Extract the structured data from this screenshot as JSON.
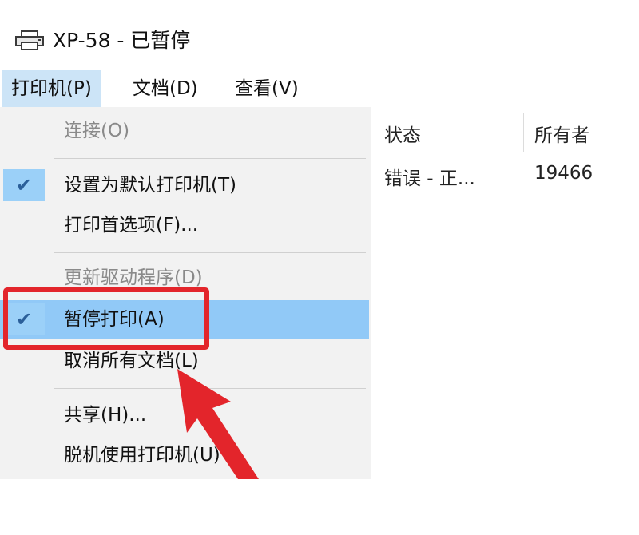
{
  "window": {
    "title": "XP-58 - 已暂停"
  },
  "menubar": {
    "items": [
      {
        "label": "打印机(P)",
        "active": true
      },
      {
        "label": "文档(D)",
        "active": false
      },
      {
        "label": "查看(V)",
        "active": false
      }
    ]
  },
  "dropdown": {
    "items": [
      {
        "label": "连接(O)",
        "disabled": true,
        "checked": false
      },
      {
        "label": "设置为默认打印机(T)",
        "disabled": false,
        "checked": true
      },
      {
        "label": "打印首选项(F)...",
        "disabled": false,
        "checked": false
      },
      {
        "label": "更新驱动程序(D)",
        "disabled": true,
        "checked": false
      },
      {
        "label": "暂停打印(A)",
        "disabled": false,
        "checked": true,
        "highlighted": true
      },
      {
        "label": "取消所有文档(L)",
        "disabled": false,
        "checked": false
      },
      {
        "label": "共享(H)...",
        "disabled": false,
        "checked": false
      },
      {
        "label": "脱机使用打印机(U)",
        "disabled": false,
        "checked": false
      }
    ]
  },
  "documents": {
    "columns": [
      "状态",
      "所有者"
    ],
    "rows": [
      [
        "错误 - 正...",
        "19466"
      ]
    ]
  },
  "icons": {
    "check": "✔",
    "printer": "printer-icon"
  },
  "colors": {
    "highlight": "#91c9f7",
    "annotation": "#e3252b"
  }
}
